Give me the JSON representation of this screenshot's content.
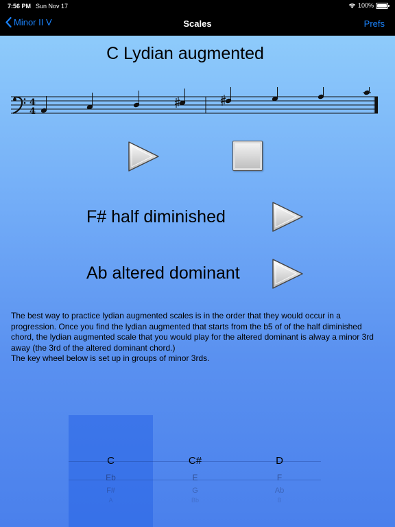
{
  "status": {
    "time": "7:56 PM",
    "date": "Sun Nov 17",
    "battery": "100%"
  },
  "nav": {
    "back_label": "Minor II V",
    "title": "Scales",
    "prefs_label": "Prefs"
  },
  "scale": {
    "title": "C Lydian augmented",
    "time_signature_top": "4",
    "time_signature_bottom": "4"
  },
  "chords": [
    {
      "label": "F# half diminished"
    },
    {
      "label": "Ab altered dominant"
    }
  ],
  "description": "The best way to practice lydian augmented scales is in the order that they would occur in a progression.  Once you find the lydian augmented that starts from the b5 of of the half diminished chord, the lydian augmented scale that you would play for the altered dominant is alway a minor 3rd away (the 3rd of the altered dominant chord.)\nThe key wheel below is set up in groups of minor 3rds.",
  "picker": {
    "columns": [
      {
        "selected": "C",
        "next": [
          "Eb",
          "F#",
          "A"
        ]
      },
      {
        "selected": "C#",
        "next": [
          "E",
          "G",
          "Bb"
        ]
      },
      {
        "selected": "D",
        "next": [
          "F",
          "Ab",
          "B"
        ]
      }
    ]
  }
}
